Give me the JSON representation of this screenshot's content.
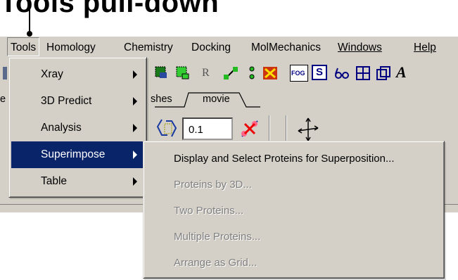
{
  "caption": "Tools pull-down",
  "menubar": {
    "items": [
      "Tools",
      "Homology",
      "Chemistry",
      "Docking",
      "MolMechanics",
      "Windows",
      "Help"
    ]
  },
  "toolbar": {
    "value_field": "0.1",
    "r_label": "R",
    "fog_label": "FOG",
    "s_label": "S",
    "a_label": "A"
  },
  "tabs": {
    "left_fragment": "e",
    "meshes_fragment": "shes",
    "movie": "movie"
  },
  "tools_menu": {
    "items": [
      {
        "label": "Xray",
        "has_submenu": true
      },
      {
        "label": "3D Predict",
        "has_submenu": true
      },
      {
        "label": "Analysis",
        "has_submenu": true
      },
      {
        "label": "Superimpose",
        "has_submenu": true,
        "selected": true
      },
      {
        "label": "Table",
        "has_submenu": true
      }
    ]
  },
  "superimpose_menu": {
    "items": [
      {
        "label": "Display and Select Proteins for Superposition...",
        "enabled": true
      },
      {
        "label": "Proteins by 3D...",
        "enabled": false
      },
      {
        "label": "Two Proteins...",
        "enabled": false
      },
      {
        "label": "Multiple Proteins...",
        "enabled": false
      },
      {
        "label": "Arrange as Grid...",
        "enabled": false
      }
    ]
  },
  "colors": {
    "window_bg": "#d4d0c8",
    "highlight": "#0a246a",
    "disabled_text": "#808080"
  }
}
